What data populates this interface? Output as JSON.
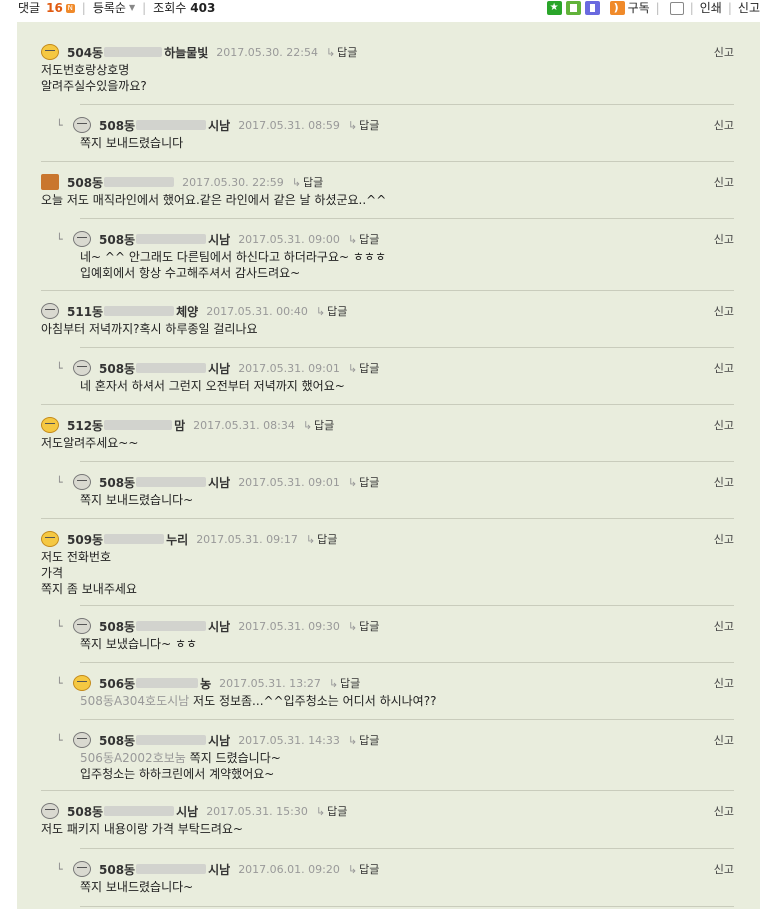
{
  "topbar": {
    "comments_label": "댓글",
    "comments_count": "16",
    "new_badge": "N",
    "sort_label": "등록순",
    "views_label": "조회수",
    "views_count": "403",
    "subscribe_label": "구독",
    "print_label": "인쇄",
    "report_label": "신고"
  },
  "comments": [
    {
      "avatar": "yellow",
      "author": "504동",
      "author_tail": "하늘물빛",
      "date": "2017.05.30. 22:54",
      "reply_label": "답글",
      "report_label": "신고",
      "lines": [
        "저도번호랑상호명",
        "알려주실수있을까요?"
      ]
    },
    {
      "avatar": "gray",
      "author": "508동",
      "author_tail": "시남",
      "date": "2017.05.31. 08:59",
      "reply_label": "답글",
      "report_label": "신고",
      "lines": [
        "쪽지 보내드렸습니다"
      ]
    },
    {
      "avatar": "fox",
      "author": "508동",
      "author_tail": "",
      "date": "2017.05.30. 22:59",
      "reply_label": "답글",
      "report_label": "신고",
      "lines": [
        "오늘 저도 매직라인에서 했어요.같은 라인에서 같은 날 하셨군요..^^"
      ]
    },
    {
      "avatar": "gray",
      "author": "508동",
      "author_tail": "시남",
      "date": "2017.05.31. 09:00",
      "reply_label": "답글",
      "report_label": "신고",
      "lines": [
        "네~ ^^ 안그래도 다른팀에서 하신다고 하더라구요~ ㅎㅎㅎ",
        "입예회에서 항상 수고해주셔서 감사드려요~"
      ]
    },
    {
      "avatar": "gray",
      "author": "511동",
      "author_tail": "체양",
      "date": "2017.05.31. 00:40",
      "reply_label": "답글",
      "report_label": "신고",
      "lines": [
        "아침부터 저녁까지?혹시 하루종일 걸리나요"
      ]
    },
    {
      "avatar": "gray",
      "author": "508동",
      "author_tail": "시남",
      "date": "2017.05.31. 09:01",
      "reply_label": "답글",
      "report_label": "신고",
      "lines": [
        "네 혼자서 하셔서 그런지 오전부터 저녁까지 했어요~"
      ]
    },
    {
      "avatar": "yellow",
      "author": "512동",
      "author_tail": "맘",
      "date": "2017.05.31. 08:34",
      "reply_label": "답글",
      "report_label": "신고",
      "lines": [
        "저도알려주세요~~"
      ]
    },
    {
      "avatar": "gray",
      "author": "508동",
      "author_tail": "시남",
      "date": "2017.05.31. 09:01",
      "reply_label": "답글",
      "report_label": "신고",
      "lines": [
        "쪽지 보내드렸습니다~"
      ]
    },
    {
      "avatar": "yellow",
      "author": "509동",
      "author_tail": "누리",
      "date": "2017.05.31. 09:17",
      "reply_label": "답글",
      "report_label": "신고",
      "lines": [
        "저도 전화번호",
        "가격",
        "쪽지 좀 보내주세요"
      ]
    },
    {
      "avatar": "gray",
      "author": "508동",
      "author_tail": "시남",
      "date": "2017.05.31. 09:30",
      "reply_label": "답글",
      "report_label": "신고",
      "lines": [
        "쪽지 보냈습니다~ ㅎㅎ"
      ]
    },
    {
      "avatar": "yellow",
      "author": "506동",
      "author_tail": "농",
      "date": "2017.05.31. 13:27",
      "reply_label": "답글",
      "report_label": "신고",
      "mention": "508동A304호도시남",
      "lines": [
        "저도 정보좀...^^입주청소는 어디서 하시나여??"
      ]
    },
    {
      "avatar": "gray",
      "author": "508동",
      "author_tail": "시남",
      "date": "2017.05.31. 14:33",
      "reply_label": "답글",
      "report_label": "신고",
      "mention": "506동A2002호보눔",
      "lines": [
        "쪽지 드렸습니다~",
        "입주청소는 하하크린에서 계약했어요~"
      ]
    },
    {
      "avatar": "gray",
      "author": "508동",
      "author_tail": "시남",
      "date": "2017.05.31. 15:30",
      "reply_label": "답글",
      "report_label": "신고",
      "lines": [
        "저도 패키지 내용이랑 가격 부탁드려요~"
      ]
    },
    {
      "avatar": "gray",
      "author": "508동",
      "author_tail": "시남",
      "date": "2017.06.01. 09:20",
      "reply_label": "답글",
      "report_label": "신고",
      "lines": [
        "쪽지 보내드렸습니다~"
      ]
    }
  ]
}
